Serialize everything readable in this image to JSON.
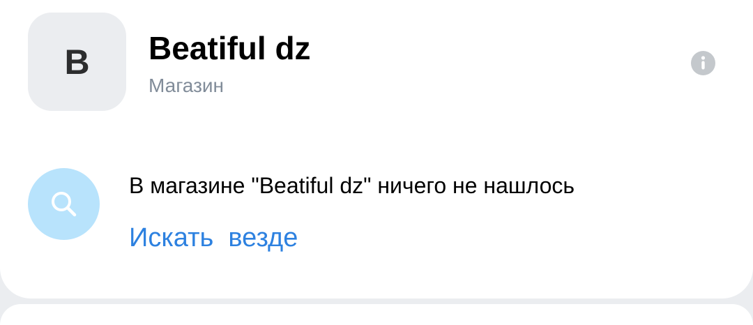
{
  "shop": {
    "avatar_letter": "B",
    "name": "Beatiful dz",
    "type": "Магазин"
  },
  "header": {
    "info_icon": "info-circle-icon"
  },
  "empty_state": {
    "icon": "search-icon",
    "message": "В магазине \"Beatiful dz\" ничего не нашлось",
    "action_label": "Искать  везде"
  },
  "colors": {
    "background": "#ebedf0",
    "card": "#ffffff",
    "avatar_bg": "#ebedf0",
    "secondary_text": "#818c99",
    "info_icon": "#c4c8cc",
    "search_circle": "#b8e3fc",
    "link": "#2d81e0"
  }
}
